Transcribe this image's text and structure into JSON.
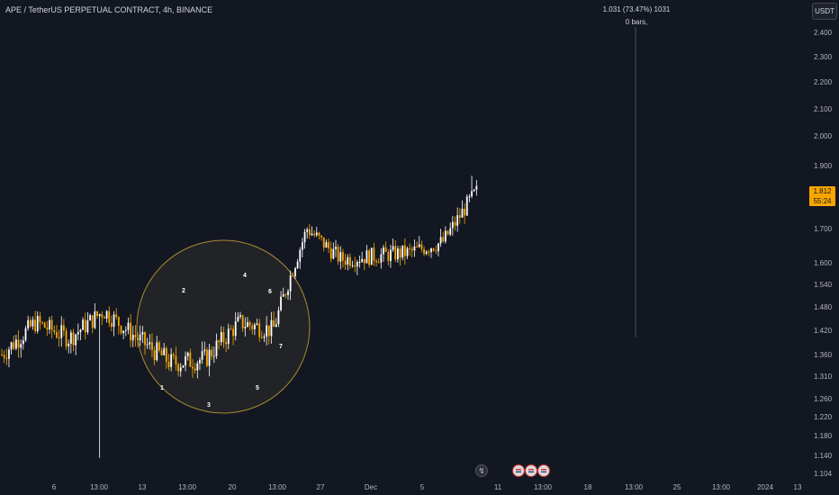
{
  "header": {
    "symbol_title": "APE / TetherUS PERPETUAL CONTRACT, 4h, BINANCE",
    "currency": "USDT"
  },
  "measure": {
    "line1": "1.031 (73.47%) 1031",
    "line2": "0 bars,"
  },
  "last_price": {
    "value": "1.812",
    "countdown": "55:24"
  },
  "colors": {
    "background": "#131722",
    "up": "#ffffff",
    "down": "#f7a600",
    "circle_fill": "rgba(228,196,100,0.07)",
    "circle_stroke": "#a88a30"
  },
  "events": [
    "flash-icon",
    "flag-icon",
    "flag-icon",
    "flag-icon"
  ],
  "chart_data": {
    "type": "candlestick",
    "y_ticks": [
      "2.400",
      "2.300",
      "2.200",
      "2.100",
      "2.000",
      "1.900",
      "1.800",
      "1.700",
      "1.600",
      "1.540",
      "1.480",
      "1.420",
      "1.360",
      "1.310",
      "1.260",
      "1.220",
      "1.180",
      "1.140",
      "1.104"
    ],
    "x_ticks": [
      "6",
      "13:00",
      "13",
      "13:00",
      "20",
      "13:00",
      "27",
      "Dec",
      "5",
      "11",
      "13:00",
      "18",
      "13:00",
      "25",
      "13:00",
      "2024",
      "13"
    ],
    "pattern_labels": [
      "1",
      "2",
      "3",
      "4",
      "5",
      "6",
      "7"
    ],
    "series_close_anchors": [
      {
        "day": "Nov 5",
        "close": 1.36
      },
      {
        "day": "Nov 8",
        "close": 1.44
      },
      {
        "day": "Nov 10",
        "close": 1.4
      },
      {
        "day": "Nov 13",
        "close": 1.47
      },
      {
        "day": "Nov 15",
        "close": 1.4
      },
      {
        "day": "Nov 17",
        "close": 1.34
      },
      {
        "day": "Nov 19",
        "close": 1.35
      },
      {
        "day": "Nov 22",
        "close": 1.44
      },
      {
        "day": "Nov 24",
        "close": 1.42
      },
      {
        "day": "Nov 26",
        "close": 1.7
      },
      {
        "day": "Nov 28",
        "close": 1.61
      },
      {
        "day": "Dec 1",
        "close": 1.62
      },
      {
        "day": "Dec 4",
        "close": 1.63
      },
      {
        "day": "Dec 7",
        "close": 1.66
      },
      {
        "day": "Dec 9",
        "close": 1.812
      }
    ],
    "notable_low": 1.135,
    "notable_high": 1.865
  }
}
